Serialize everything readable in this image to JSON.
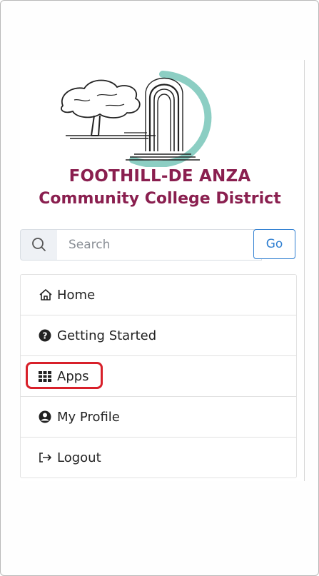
{
  "org": {
    "name_line1": "FOOTHILL-DE ANZA",
    "name_line2": "Community College District",
    "brand_color": "#8a1f4f"
  },
  "search": {
    "placeholder": "Search",
    "value": "",
    "go_label": "Go",
    "accent": "#2f7fd1"
  },
  "nav": {
    "items": [
      {
        "label": "Home",
        "icon": "home-icon"
      },
      {
        "label": "Getting Started",
        "icon": "question-circle-icon"
      },
      {
        "label": "Apps",
        "icon": "grid-icon",
        "highlighted": true
      },
      {
        "label": "My Profile",
        "icon": "user-circle-icon"
      },
      {
        "label": "Logout",
        "icon": "logout-icon"
      }
    ]
  },
  "highlight_color": "#d8202a"
}
